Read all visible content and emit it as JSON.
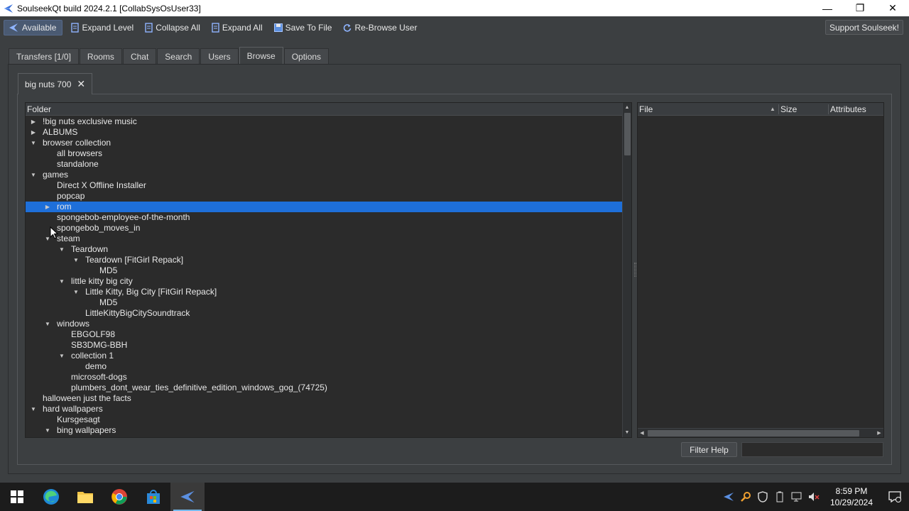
{
  "window": {
    "title": "SoulseekQt build 2024.2.1 [CollabSysOsUser33]",
    "controls": {
      "minimize": "—",
      "restore": "❐",
      "close": "✕"
    }
  },
  "toolbar": {
    "status": "Available",
    "expand_level": "Expand Level",
    "collapse_all": "Collapse All",
    "expand_all": "Expand All",
    "save_to_file": "Save To File",
    "rebrowse_user": "Re-Browse User",
    "support": "Support Soulseek!"
  },
  "tabs": [
    {
      "label": "Transfers [1/0]",
      "active": false
    },
    {
      "label": "Rooms",
      "active": false
    },
    {
      "label": "Chat",
      "active": false
    },
    {
      "label": "Search",
      "active": false
    },
    {
      "label": "Users",
      "active": false
    },
    {
      "label": "Browse",
      "active": true
    },
    {
      "label": "Options",
      "active": false
    }
  ],
  "browse_tab": {
    "label": "big nuts 700",
    "close": "✕"
  },
  "folder_panel": {
    "header": "Folder",
    "rows": [
      {
        "label": "!big nuts exclusive music",
        "depth": 0,
        "arrow": "collapsed"
      },
      {
        "label": "ALBUMS",
        "depth": 0,
        "arrow": "collapsed"
      },
      {
        "label": "browser collection",
        "depth": 0,
        "arrow": "expanded"
      },
      {
        "label": "all browsers",
        "depth": 1,
        "arrow": "none"
      },
      {
        "label": "standalone",
        "depth": 1,
        "arrow": "none"
      },
      {
        "label": "games",
        "depth": 0,
        "arrow": "expanded"
      },
      {
        "label": "Direct X Offline Installer",
        "depth": 1,
        "arrow": "none"
      },
      {
        "label": "popcap",
        "depth": 1,
        "arrow": "none"
      },
      {
        "label": "rom",
        "depth": 1,
        "arrow": "collapsed",
        "selected": true
      },
      {
        "label": "spongebob-employee-of-the-month",
        "depth": 1,
        "arrow": "none"
      },
      {
        "label": "spongebob_moves_in",
        "depth": 1,
        "arrow": "none"
      },
      {
        "label": "steam",
        "depth": 1,
        "arrow": "expanded"
      },
      {
        "label": "Teardown",
        "depth": 2,
        "arrow": "expanded"
      },
      {
        "label": "Teardown [FitGirl Repack]",
        "depth": 3,
        "arrow": "expanded"
      },
      {
        "label": "MD5",
        "depth": 4,
        "arrow": "none"
      },
      {
        "label": "little kitty big city",
        "depth": 2,
        "arrow": "expanded"
      },
      {
        "label": "Little Kitty, Big City [FitGirl Repack]",
        "depth": 3,
        "arrow": "expanded"
      },
      {
        "label": "MD5",
        "depth": 4,
        "arrow": "none"
      },
      {
        "label": "LittleKittyBigCitySoundtrack",
        "depth": 3,
        "arrow": "none"
      },
      {
        "label": "windows",
        "depth": 1,
        "arrow": "expanded"
      },
      {
        "label": "EBGOLF98",
        "depth": 2,
        "arrow": "none"
      },
      {
        "label": "SB3DMG-BBH",
        "depth": 2,
        "arrow": "none"
      },
      {
        "label": "collection 1",
        "depth": 2,
        "arrow": "expanded"
      },
      {
        "label": "demo",
        "depth": 3,
        "arrow": "none"
      },
      {
        "label": "microsoft-dogs",
        "depth": 2,
        "arrow": "none"
      },
      {
        "label": "plumbers_dont_wear_ties_definitive_edition_windows_gog_(74725)",
        "depth": 2,
        "arrow": "none"
      },
      {
        "label": "halloween just the facts",
        "depth": 0,
        "arrow": "none"
      },
      {
        "label": "hard wallpapers",
        "depth": 0,
        "arrow": "expanded"
      },
      {
        "label": "Kursgesagt",
        "depth": 1,
        "arrow": "none"
      },
      {
        "label": "bing wallpapers",
        "depth": 1,
        "arrow": "expanded"
      }
    ]
  },
  "file_panel": {
    "columns": {
      "file": "File",
      "size": "Size",
      "attributes": "Attributes"
    }
  },
  "filter": {
    "button": "Filter Help",
    "value": ""
  },
  "taskbar": {
    "clock_time": "8:59 PM",
    "clock_date": "10/29/2024"
  },
  "colors": {
    "selection": "#1e6fd9",
    "background": "#3c3f41",
    "panel": "#2b2b2b"
  }
}
